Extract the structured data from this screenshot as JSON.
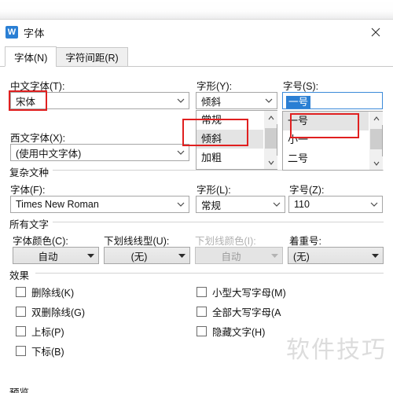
{
  "window": {
    "title": "字体",
    "app_icon": "wps-writer-icon",
    "close_label": "✕"
  },
  "tabs": [
    {
      "label": "字体(N)",
      "active": true
    },
    {
      "label": "字符间距(R)",
      "active": false
    }
  ],
  "chinese_font": {
    "label": "中文字体(T):",
    "value": "宋体"
  },
  "western_font": {
    "label": "西文字体(X):",
    "value": "(使用中文字体)"
  },
  "font_style": {
    "label": "字形(Y):",
    "value": "倾斜",
    "options": [
      "常规",
      "倾斜",
      "加粗"
    ],
    "highlighted": "倾斜"
  },
  "font_size": {
    "label": "字号(S):",
    "value": "一号",
    "options": [
      "一号",
      "小一",
      "二号"
    ],
    "highlighted": "一号"
  },
  "complex_script": {
    "group_label": "复杂文种",
    "font": {
      "label": "字体(F):",
      "value": "Times New Roman"
    },
    "style": {
      "label": "字形(L):",
      "value": "常规"
    },
    "size": {
      "label": "字号(Z):",
      "value": "110"
    }
  },
  "all_text": {
    "group_label": "所有文字",
    "font_color": {
      "label": "字体颜色(C):",
      "value": "自动",
      "disabled": false
    },
    "underline_style": {
      "label": "下划线线型(U):",
      "value": "(无)",
      "disabled": false
    },
    "underline_color": {
      "label": "下划线颜色(I):",
      "value": "自动",
      "disabled": true
    },
    "emphasis_mark": {
      "label": "着重号:",
      "value": "(无)",
      "disabled": false
    }
  },
  "effects": {
    "group_label": "效果",
    "left_column": [
      {
        "label": "删除线(K)",
        "checked": false
      },
      {
        "label": "双删除线(G)",
        "checked": false
      },
      {
        "label": "上标(P)",
        "checked": false
      },
      {
        "label": "下标(B)",
        "checked": false
      }
    ],
    "right_column": [
      {
        "label": "小型大写字母(M)",
        "checked": false
      },
      {
        "label": "全部大写字母(A",
        "checked": false
      },
      {
        "label": "隐藏文字(H)",
        "checked": false
      }
    ]
  },
  "preview": {
    "group_label": "预览"
  },
  "watermark": {
    "text": "软件技巧"
  },
  "colors": {
    "accent": "#2a7fd4",
    "annotation": "#e02020",
    "dialog_bg": "#ffffff",
    "border": "#a6a6a6",
    "highlight": "#e4e4e4"
  }
}
